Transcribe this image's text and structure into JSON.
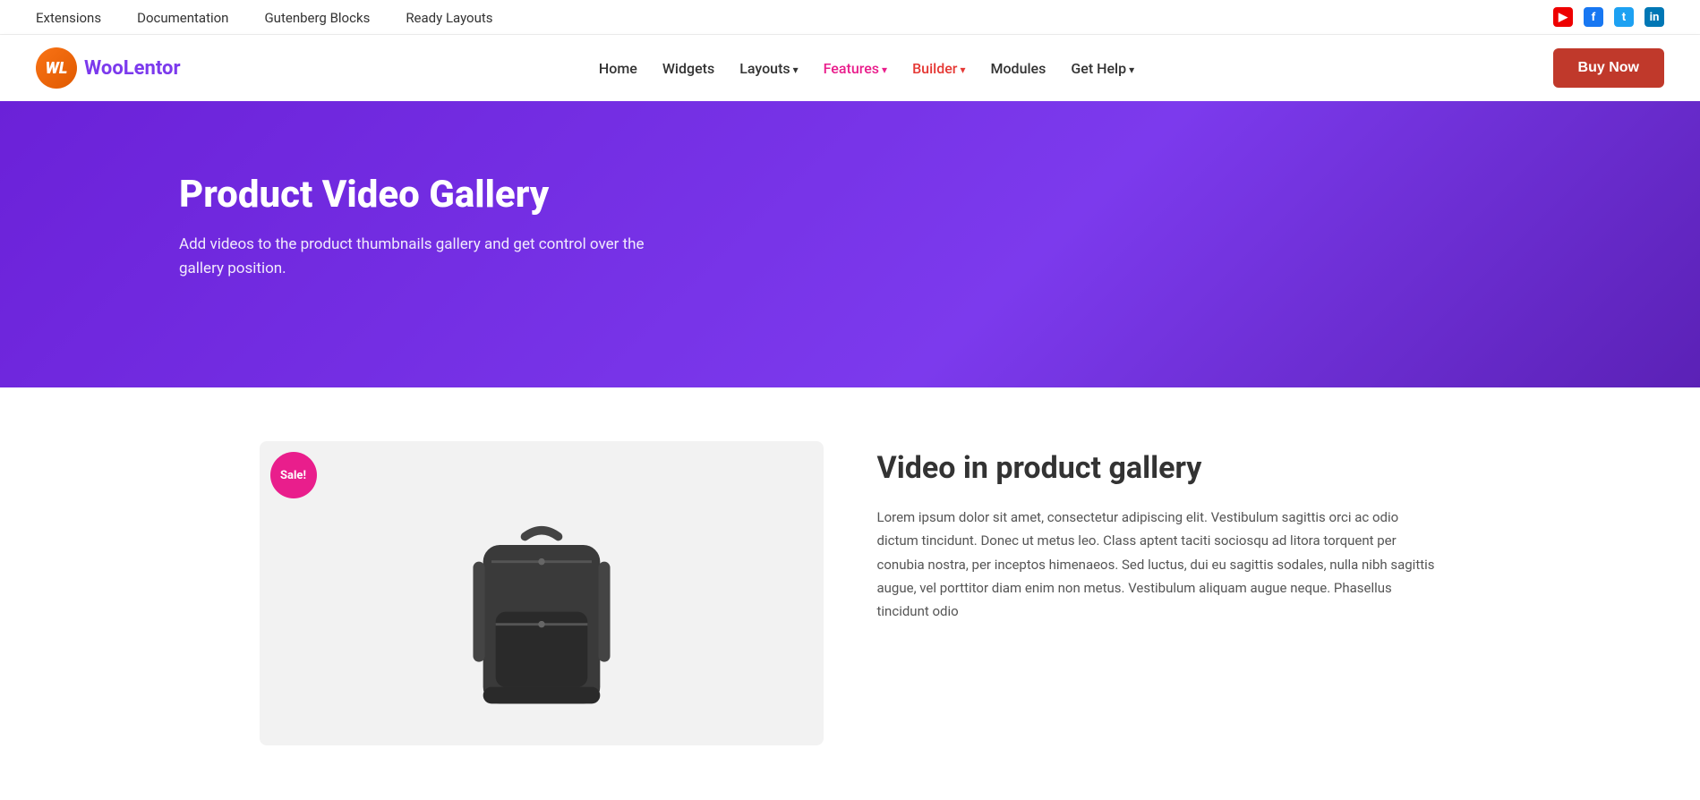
{
  "top_bar": {
    "nav": [
      {
        "label": "Extensions",
        "href": "#"
      },
      {
        "label": "Documentation",
        "href": "#"
      },
      {
        "label": "Gutenberg Blocks",
        "href": "#"
      },
      {
        "label": "Ready Layouts",
        "href": "#"
      }
    ],
    "social": [
      {
        "name": "youtube",
        "icon": "▶",
        "label": "YouTube"
      },
      {
        "name": "facebook",
        "icon": "f",
        "label": "Facebook"
      },
      {
        "name": "twitter",
        "icon": "t",
        "label": "Twitter"
      },
      {
        "name": "linkedin",
        "icon": "in",
        "label": "LinkedIn"
      }
    ]
  },
  "header": {
    "logo_initials": "WL",
    "logo_text_before": "Woo",
    "logo_text_after": "Lentor",
    "nav": [
      {
        "label": "Home",
        "has_arrow": false,
        "class": ""
      },
      {
        "label": "Widgets",
        "has_arrow": false,
        "class": ""
      },
      {
        "label": "Layouts",
        "has_arrow": true,
        "class": ""
      },
      {
        "label": "Features",
        "has_arrow": true,
        "class": "active-pink"
      },
      {
        "label": "Builder",
        "has_arrow": true,
        "class": "active-red"
      },
      {
        "label": "Modules",
        "has_arrow": false,
        "class": ""
      },
      {
        "label": "Get Help",
        "has_arrow": true,
        "class": ""
      }
    ],
    "buy_now": "Buy Now"
  },
  "hero": {
    "title": "Product Video Gallery",
    "subtitle": "Add videos to the product thumbnails gallery and get control over the gallery position."
  },
  "content": {
    "product_section_title": "Video in product gallery",
    "product_section_text": "Lorem ipsum dolor sit amet, consectetur adipiscing elit. Vestibulum sagittis orci ac odio dictum tincidunt. Donec ut metus leo. Class aptent taciti sociosqu ad litora torquent per conubia nostra, per inceptos himenaeos. Sed luctus, dui eu sagittis sodales, nulla nibh sagittis augue, vel porttitor diam enim non metus. Vestibulum aliquam augue neque. Phasellus tincidunt odio",
    "sale_badge": "Sale!"
  }
}
